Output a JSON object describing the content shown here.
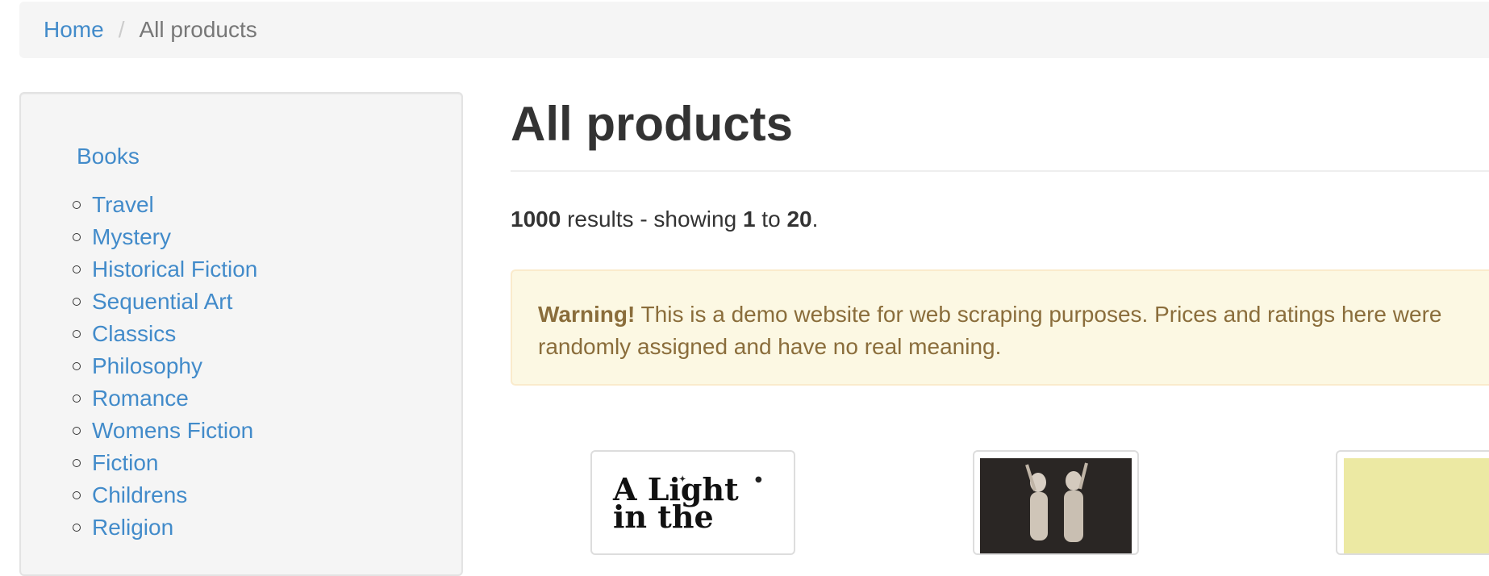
{
  "breadcrumb": {
    "home": "Home",
    "separator": "/",
    "current": "All products"
  },
  "sidebar": {
    "root_label": "Books",
    "categories": [
      "Travel",
      "Mystery",
      "Historical Fiction",
      "Sequential Art",
      "Classics",
      "Philosophy",
      "Romance",
      "Womens Fiction",
      "Fiction",
      "Childrens",
      "Religion"
    ]
  },
  "main": {
    "title": "All products",
    "results": {
      "total": "1000",
      "text1": " results - showing ",
      "from": "1",
      "text2": " to ",
      "to": "20",
      "text3": "."
    },
    "alert": {
      "label": "Warning!",
      "message": " This is a demo website for web scraping purposes. Prices and ratings here were randomly assigned and have no real meaning."
    },
    "products": [
      {
        "cover_text": "A Light in the"
      },
      {
        "cover_text": ""
      },
      {
        "cover_text": ""
      }
    ]
  },
  "colors": {
    "link": "#428bca",
    "alert_bg": "#fcf8e3",
    "alert_text": "#8a6d3b",
    "panel_bg": "#f5f5f5"
  }
}
